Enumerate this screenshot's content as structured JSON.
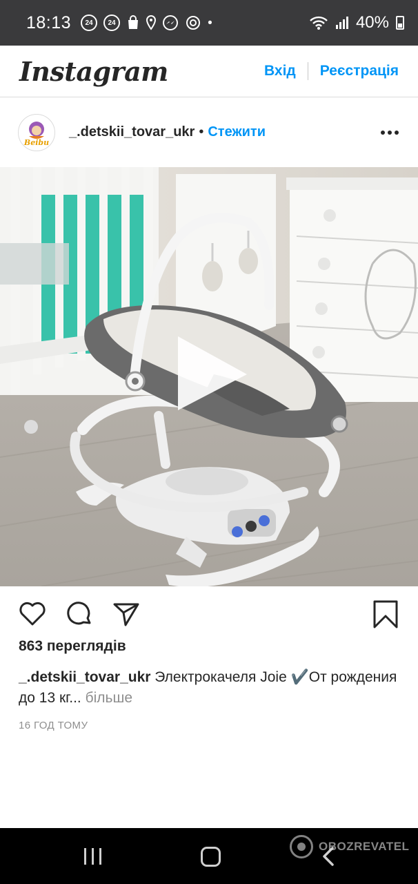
{
  "status_bar": {
    "time": "18:13",
    "notif_badge_1": "24",
    "notif_badge_2": "24",
    "battery_percent": "40%",
    "icons": [
      "badge-24-icon",
      "badge-24-icon",
      "shopping-bag-icon",
      "location-pin-icon",
      "messenger-icon",
      "sync-icon",
      "more-dot-icon",
      "wifi-icon",
      "signal-icon",
      "battery-icon"
    ]
  },
  "header": {
    "logo": "Instagram",
    "login": "Вхід",
    "signup": "Реєстрація"
  },
  "post": {
    "avatar_text": "Beibu",
    "username": "_.detskii_tovar_ukr",
    "follow": "Стежити",
    "views": "863 переглядів",
    "caption_user": "_.detskii_tovar_ukr",
    "caption_text": " Электрокачеля Joie ✔️От рождения до 13 кг...",
    "caption_more": " більше",
    "time_ago": "16 ГОД ТОМУ"
  },
  "watermark": {
    "text": "OBOZREVATEL"
  },
  "colors": {
    "accent": "#0095f6",
    "text": "#262626",
    "muted": "#8e8e8e",
    "status_bar": "#3a3a3c",
    "nav_bar": "#000000"
  }
}
